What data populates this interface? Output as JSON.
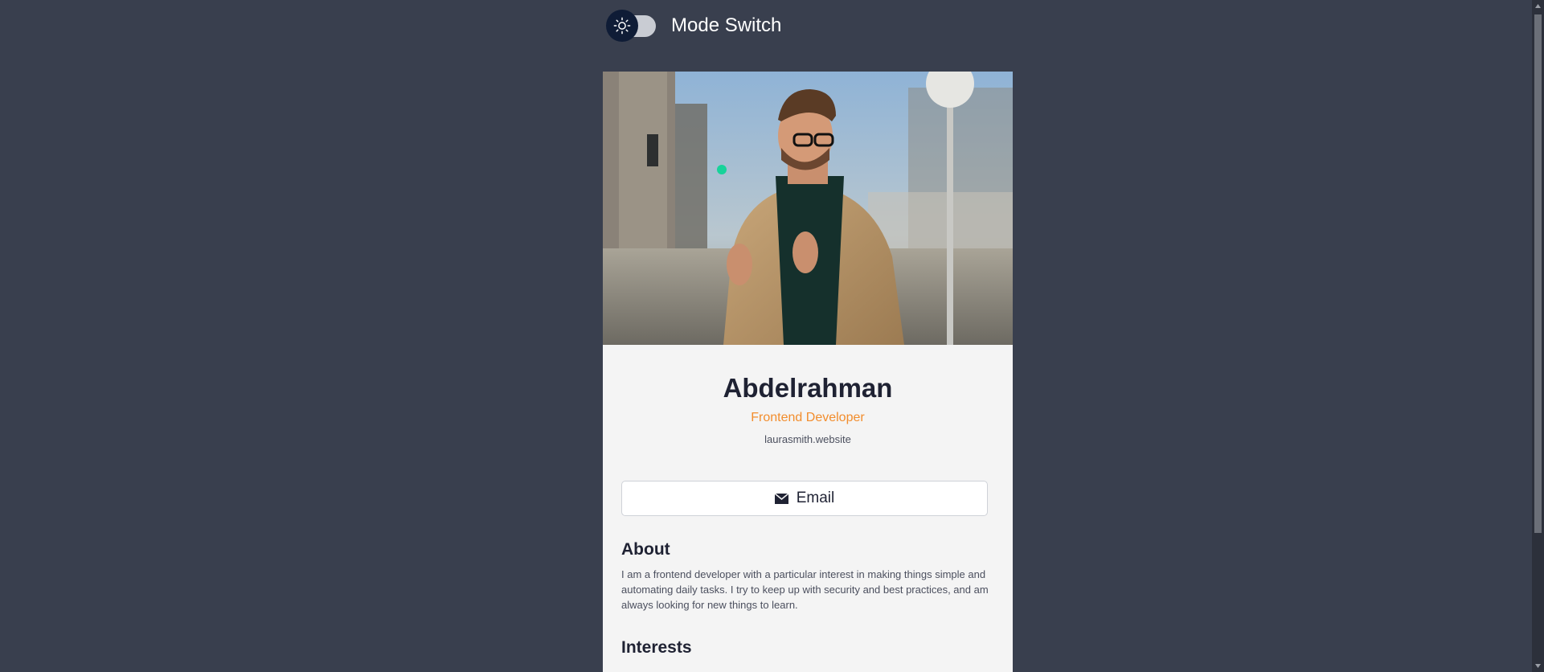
{
  "mode_switch": {
    "label": "Mode Switch",
    "icon": "sun-icon",
    "state": "light"
  },
  "profile": {
    "photo_description_icon": "profile-photo",
    "name": "Abdelrahman",
    "role": "Frontend Developer",
    "website": "laurasmith.website"
  },
  "actions": {
    "email_label": "Email",
    "email_icon": "envelope-icon"
  },
  "about": {
    "heading": "About",
    "text": "I am a frontend developer with a particular interest in making things simple and automating daily tasks. I try to keep up with security and best practices, and am always looking for new things to learn."
  },
  "interests": {
    "heading": "Interests"
  },
  "colors": {
    "background": "#393f4e",
    "card": "#f4f4f4",
    "accent": "#f28d2d",
    "heading": "#1f2233"
  }
}
